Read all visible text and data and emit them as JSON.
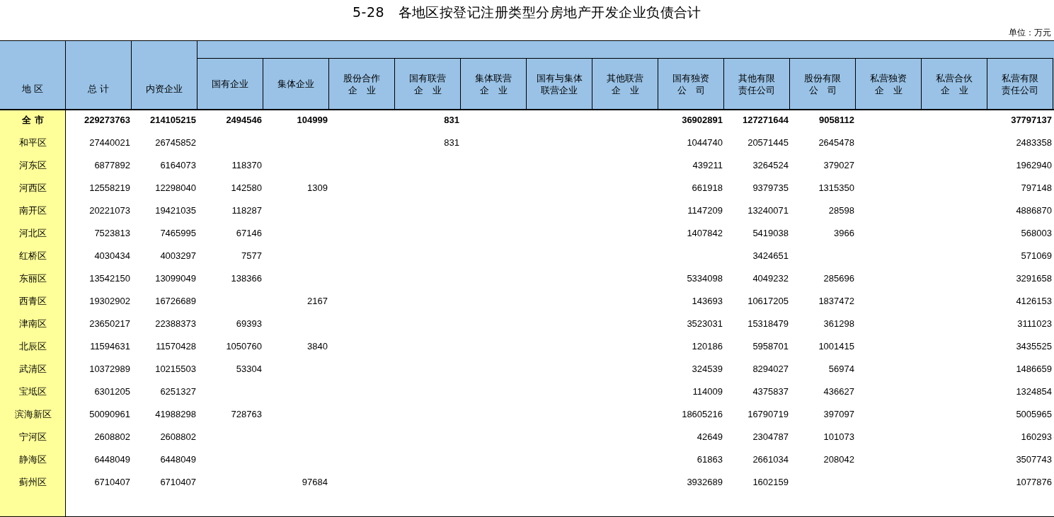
{
  "title": "5-28　各地区按登记注册类型分房地产开发企业负债合计",
  "unit": "单位：万元",
  "table": {
    "columns": [
      {
        "lines": [
          "地 区"
        ],
        "kind": "main"
      },
      {
        "lines": [
          "总 计"
        ],
        "kind": "main"
      },
      {
        "lines": [
          "内资企业"
        ],
        "kind": "main"
      },
      {
        "lines": [
          "国有企业"
        ],
        "kind": "sub"
      },
      {
        "lines": [
          "集体企业"
        ],
        "kind": "sub"
      },
      {
        "lines": [
          "股份合作",
          "企　业"
        ],
        "kind": "sub"
      },
      {
        "lines": [
          "国有联营",
          "企　业"
        ],
        "kind": "sub"
      },
      {
        "lines": [
          "集体联营",
          "企　业"
        ],
        "kind": "sub"
      },
      {
        "lines": [
          "国有与集体",
          "联营企业"
        ],
        "kind": "sub"
      },
      {
        "lines": [
          "其他联营",
          "企　业"
        ],
        "kind": "sub"
      },
      {
        "lines": [
          "国有独资",
          "公　司"
        ],
        "kind": "sub"
      },
      {
        "lines": [
          "其他有限",
          "责任公司"
        ],
        "kind": "sub"
      },
      {
        "lines": [
          "股份有限",
          "公　司"
        ],
        "kind": "sub"
      },
      {
        "lines": [
          "私营独资",
          "企　业"
        ],
        "kind": "sub"
      },
      {
        "lines": [
          "私营合伙",
          "企　业"
        ],
        "kind": "sub"
      },
      {
        "lines": [
          "私营有限",
          "责任公司"
        ],
        "kind": "sub"
      }
    ],
    "rows": [
      {
        "kind": "total",
        "cells": [
          "全 市",
          "229273763",
          "214105215",
          "2494546",
          "104999",
          null,
          "831",
          null,
          null,
          null,
          "36902891",
          "127271644",
          "9058112",
          null,
          null,
          "37797137"
        ]
      },
      {
        "kind": "district",
        "cells": [
          "和平区",
          "27440021",
          "26745852",
          null,
          null,
          null,
          "831",
          null,
          null,
          null,
          "1044740",
          "20571445",
          "2645478",
          null,
          null,
          "2483358"
        ]
      },
      {
        "kind": "district",
        "cells": [
          "河东区",
          "6877892",
          "6164073",
          "118370",
          null,
          null,
          null,
          null,
          null,
          null,
          "439211",
          "3264524",
          "379027",
          null,
          null,
          "1962940"
        ]
      },
      {
        "kind": "district",
        "cells": [
          "河西区",
          "12558219",
          "12298040",
          "142580",
          "1309",
          null,
          null,
          null,
          null,
          null,
          "661918",
          "9379735",
          "1315350",
          null,
          null,
          "797148"
        ]
      },
      {
        "kind": "district",
        "cells": [
          "南开区",
          "20221073",
          "19421035",
          "118287",
          null,
          null,
          null,
          null,
          null,
          null,
          "1147209",
          "13240071",
          "28598",
          null,
          null,
          "4886870"
        ]
      },
      {
        "kind": "district",
        "cells": [
          "河北区",
          "7523813",
          "7465995",
          "67146",
          null,
          null,
          null,
          null,
          null,
          null,
          "1407842",
          "5419038",
          "3966",
          null,
          null,
          "568003"
        ]
      },
      {
        "kind": "district",
        "cells": [
          "红桥区",
          "4030434",
          "4003297",
          "7577",
          null,
          null,
          null,
          null,
          null,
          null,
          null,
          "3424651",
          null,
          null,
          null,
          "571069"
        ]
      },
      {
        "kind": "district",
        "cells": [
          "东丽区",
          "13542150",
          "13099049",
          "138366",
          null,
          null,
          null,
          null,
          null,
          null,
          "5334098",
          "4049232",
          "285696",
          null,
          null,
          "3291658"
        ]
      },
      {
        "kind": "district",
        "cells": [
          "西青区",
          "19302902",
          "16726689",
          null,
          "2167",
          null,
          null,
          null,
          null,
          null,
          "143693",
          "10617205",
          "1837472",
          null,
          null,
          "4126153"
        ]
      },
      {
        "kind": "district",
        "cells": [
          "津南区",
          "23650217",
          "22388373",
          "69393",
          null,
          null,
          null,
          null,
          null,
          null,
          "3523031",
          "15318479",
          "361298",
          null,
          null,
          "3111023"
        ]
      },
      {
        "kind": "district",
        "cells": [
          "北辰区",
          "11594631",
          "11570428",
          "1050760",
          "3840",
          null,
          null,
          null,
          null,
          null,
          "120186",
          "5958701",
          "1001415",
          null,
          null,
          "3435525"
        ]
      },
      {
        "kind": "district",
        "cells": [
          "武清区",
          "10372989",
          "10215503",
          "53304",
          null,
          null,
          null,
          null,
          null,
          null,
          "324539",
          "8294027",
          "56974",
          null,
          null,
          "1486659"
        ]
      },
      {
        "kind": "district",
        "cells": [
          "宝坻区",
          "6301205",
          "6251327",
          null,
          null,
          null,
          null,
          null,
          null,
          null,
          "114009",
          "4375837",
          "436627",
          null,
          null,
          "1324854"
        ]
      },
      {
        "kind": "district",
        "cells": [
          "滨海新区",
          "50090961",
          "41988298",
          "728763",
          null,
          null,
          null,
          null,
          null,
          null,
          "18605216",
          "16790719",
          "397097",
          null,
          null,
          "5005965"
        ]
      },
      {
        "kind": "district",
        "cells": [
          "宁河区",
          "2608802",
          "2608802",
          null,
          null,
          null,
          null,
          null,
          null,
          null,
          "42649",
          "2304787",
          "101073",
          null,
          null,
          "160293"
        ]
      },
      {
        "kind": "district",
        "cells": [
          "静海区",
          "6448049",
          "6448049",
          null,
          null,
          null,
          null,
          null,
          null,
          null,
          "61863",
          "2661034",
          "208042",
          null,
          null,
          "3507743"
        ]
      },
      {
        "kind": "district",
        "cells": [
          "蓟州区",
          "6710407",
          "6710407",
          null,
          "97684",
          null,
          null,
          null,
          null,
          null,
          "3932689",
          "1602159",
          null,
          null,
          null,
          "1077876"
        ]
      }
    ]
  }
}
